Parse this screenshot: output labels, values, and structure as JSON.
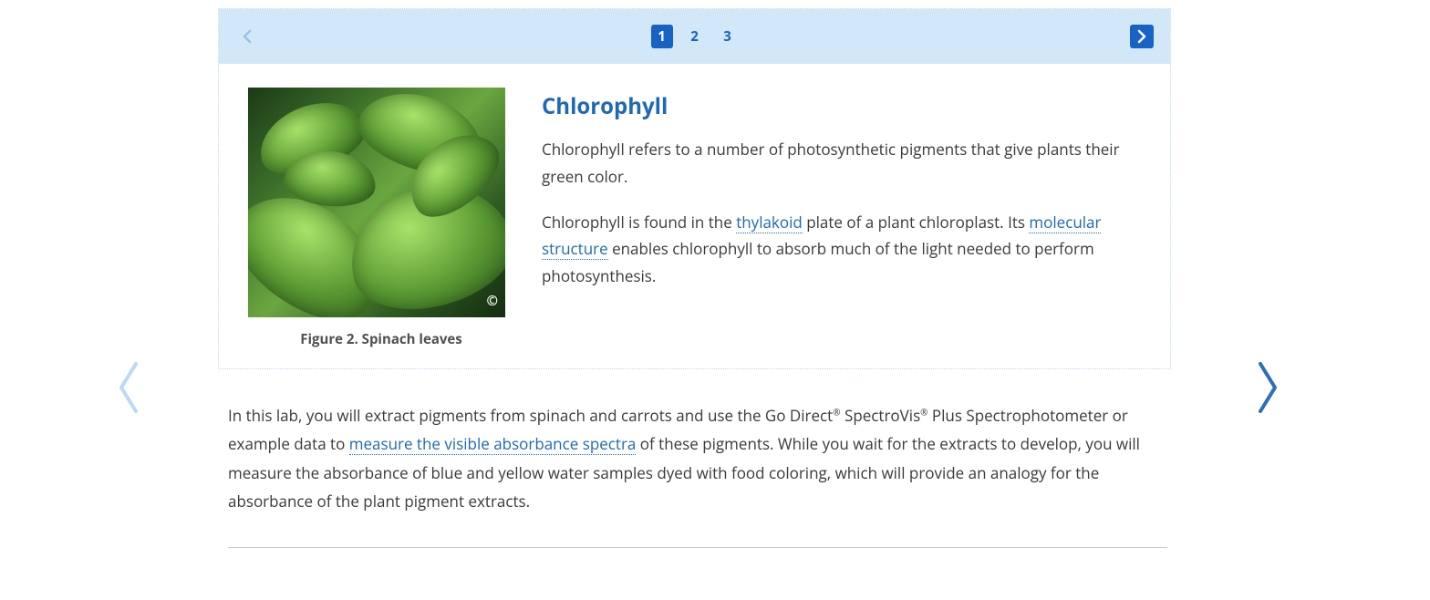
{
  "pager": {
    "pages": [
      "1",
      "2",
      "3"
    ],
    "active_index": 0
  },
  "card": {
    "figure_caption": "Figure 2. Spinach leaves",
    "copyright_symbol": "©",
    "title": "Chlorophyll",
    "para1": "Chlorophyll refers to a number of photosynthetic pigments that give plants their green color.",
    "para2_pre": "Chlorophyll is found in the ",
    "para2_link1": "thylakoid",
    "para2_mid": " plate of a plant chloroplast. Its ",
    "para2_link2": "molecular structure",
    "para2_post": " enables chlorophyll to absorb much of the light needed to perform photosynthesis."
  },
  "below": {
    "seg1": "In this lab, you will extract pigments from spinach and carrots and use the Go Direct",
    "reg1": "®",
    "seg2": " SpectroVis",
    "reg2": "®",
    "seg3": " Plus Spectrophotometer or example data to ",
    "link": "measure the visible absorbance spectra",
    "seg4": " of these pigments. While you wait for the extracts to develop, you will measure the absorbance of blue and yellow water samples dyed with food coloring, which will provide an analogy for the absorbance of the plant pigment extracts."
  }
}
